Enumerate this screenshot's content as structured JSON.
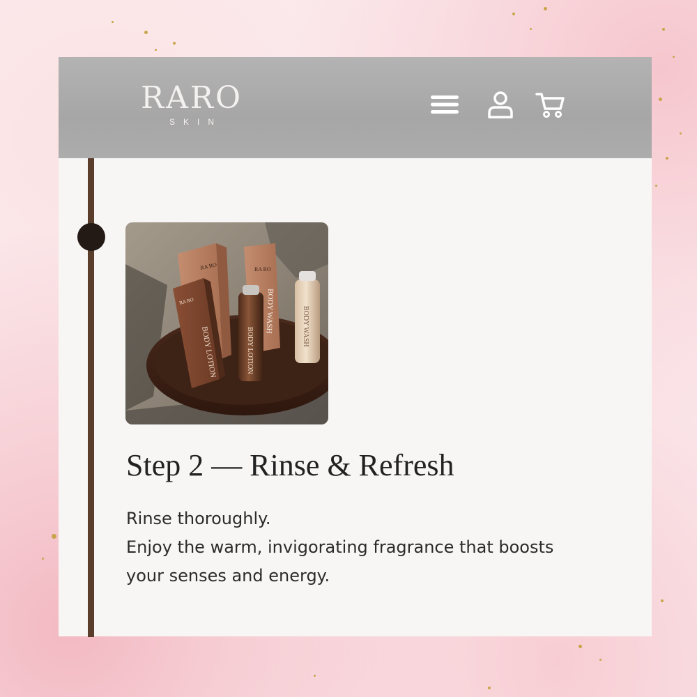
{
  "brand": {
    "name": "RARO",
    "sub": "SKIN"
  },
  "header": {
    "icons": [
      "menu-icon",
      "account-icon",
      "cart-icon"
    ]
  },
  "step": {
    "title": "Step 2 — Rinse & Refresh",
    "lines": [
      "Rinse thoroughly.",
      "Enjoy the warm, invigorating fragrance that boosts",
      "your senses and energy."
    ],
    "image": {
      "product_labels": [
        "RA RO",
        "BODY LOTION",
        "BODY WASH"
      ]
    }
  },
  "colors": {
    "header_bg": "#a9a8a8",
    "card_bg": "#f8f6f5",
    "timeline": "#5a3e2b",
    "timeline_dot": "#231a16",
    "backdrop_pink": "#f3b9c2",
    "glitter_gold": "#c9a44a"
  }
}
